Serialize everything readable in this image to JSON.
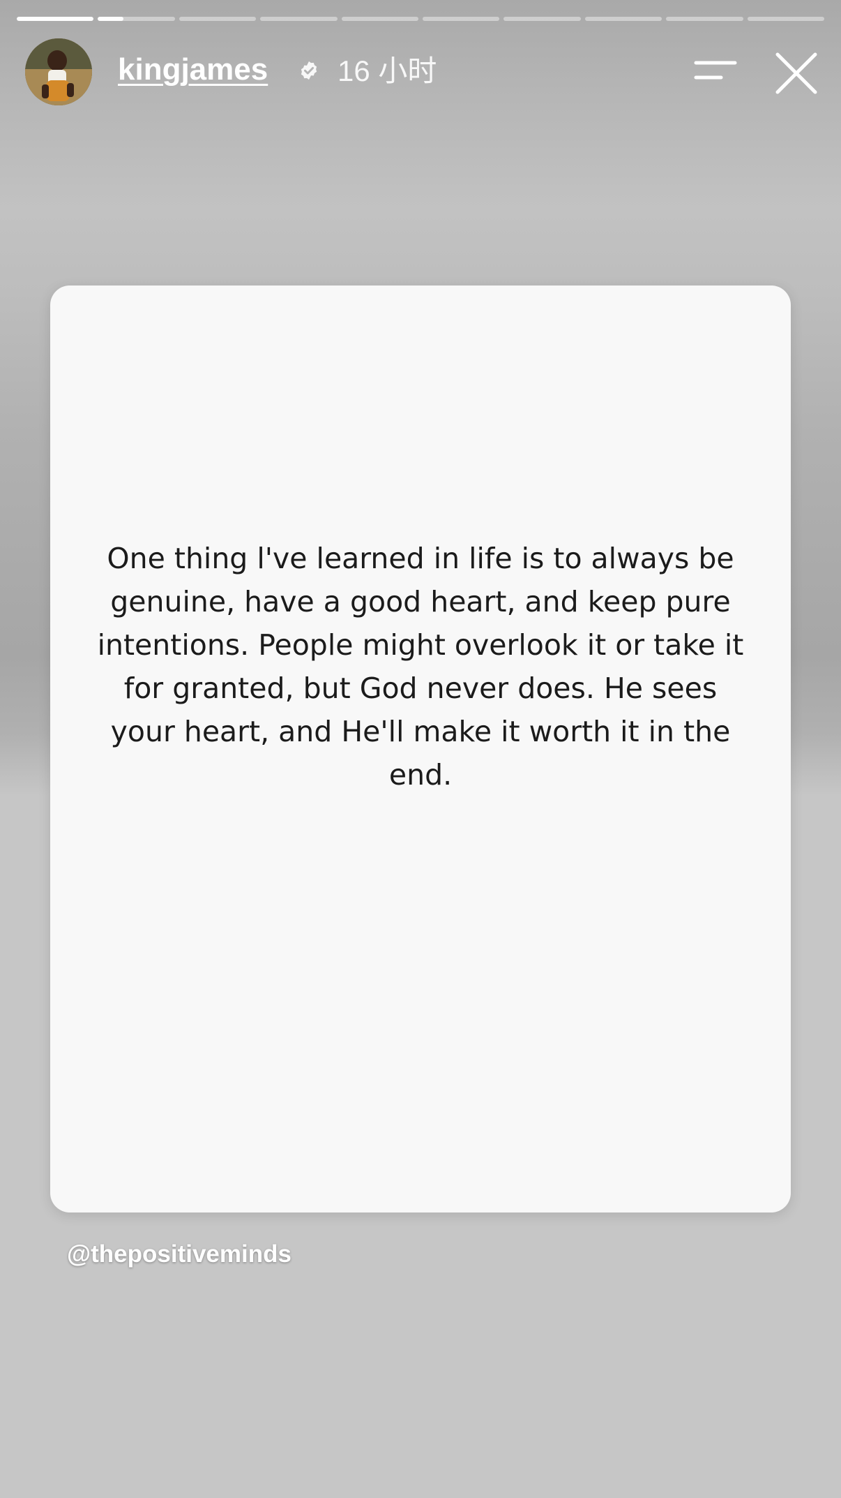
{
  "story": {
    "segment_count": 10,
    "active_segment": 2,
    "active_segment_progress": 0.33
  },
  "header": {
    "username": "kingjames",
    "verified_icon": "verified-badge-icon",
    "time": "16 小时",
    "menu_icon": "menu-icon",
    "close_icon": "close-icon"
  },
  "post": {
    "quote": "One thing l've learned in life is to always be genuine, have a good heart, and keep pure intentions. People might overlook it or take it for granted, but God never does. He sees your heart, and He'll make it worth it in the end.",
    "mention": "@thepositiveminds"
  },
  "colors": {
    "background": "#c6c6c6",
    "card": "#f8f8f8",
    "text": "#1b1b1b",
    "header_text": "#ffffff"
  }
}
